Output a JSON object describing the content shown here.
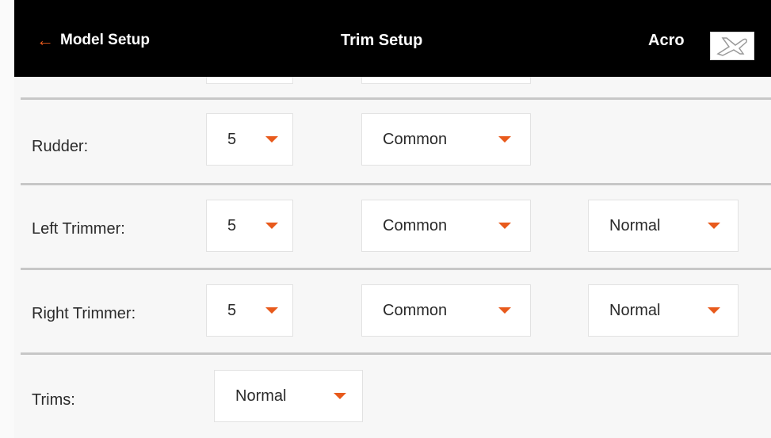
{
  "header": {
    "back_label": "Model Setup",
    "title": "Trim Setup",
    "model_name": "Acro",
    "model_icon": "airplane-icon",
    "accent_color": "#e85a1c"
  },
  "rows": [
    {
      "label": "Rudder:",
      "step": "5",
      "mode": "Common"
    },
    {
      "label": "Left Trimmer:",
      "step": "5",
      "mode": "Common",
      "direction": "Normal"
    },
    {
      "label": "Right Trimmer:",
      "step": "5",
      "mode": "Common",
      "direction": "Normal"
    },
    {
      "label": "Trims:",
      "type": "Normal"
    }
  ]
}
